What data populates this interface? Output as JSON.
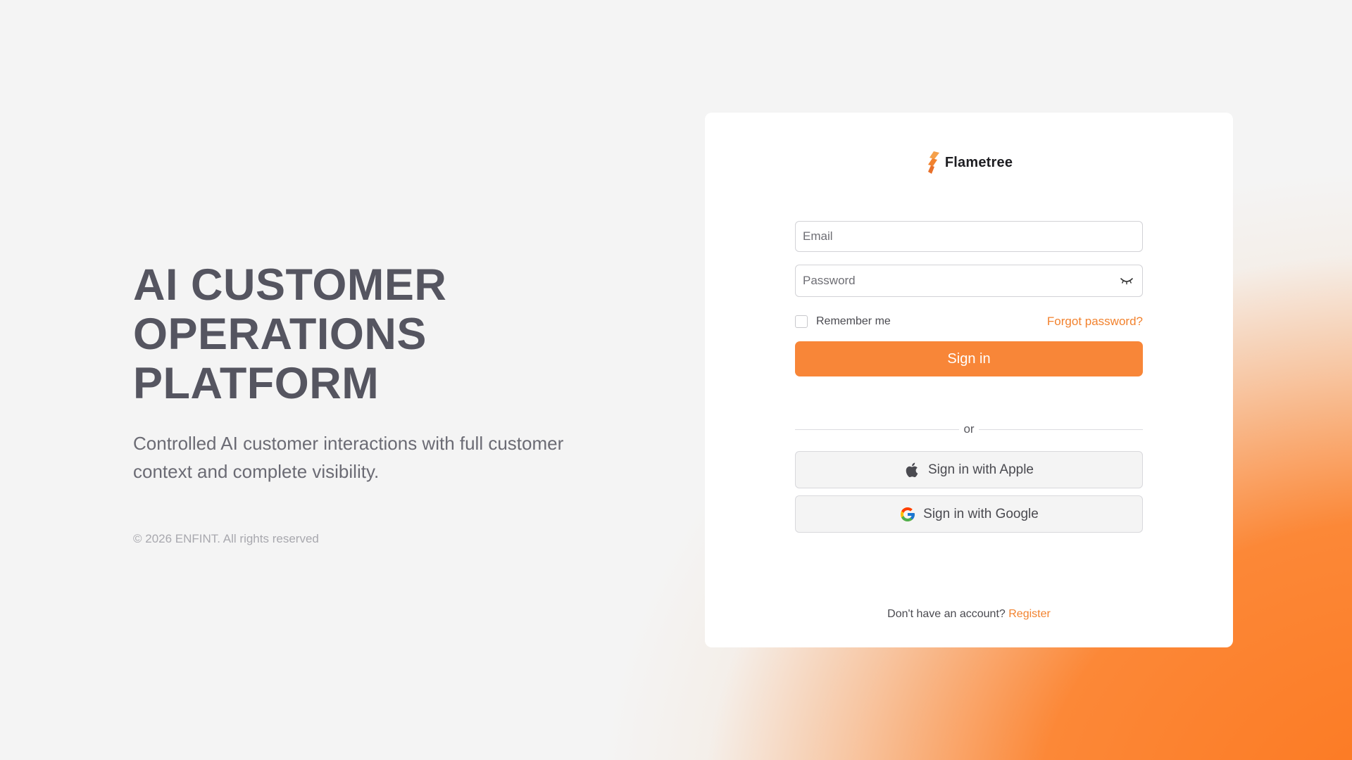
{
  "hero": {
    "title_lines": [
      "AI CUSTOMER",
      "OPERATIONS",
      "PLATFORM"
    ],
    "subtitle": "Controlled AI customer interactions with full customer context and complete visibility.",
    "copyright": "© 2026 ENFINT. All rights reserved"
  },
  "brand": {
    "name": "Flametree",
    "logo_icon": "flame-logo-icon",
    "color": "#f2822e"
  },
  "login": {
    "email_placeholder": "Email",
    "email_value": "",
    "password_placeholder": "Password",
    "password_value": "",
    "password_toggle_icon": "eye-closed-icon",
    "remember_label": "Remember me",
    "remember_checked": false,
    "forgot_label": "Forgot password?",
    "signin_label": "Sign in",
    "divider_label": "or",
    "apple_label": "Sign in with Apple",
    "apple_icon": "apple-icon",
    "google_label": "Sign in with Google",
    "google_icon": "google-icon",
    "register_prompt": "Don't have an account?",
    "register_label": "Register"
  },
  "colors": {
    "accent": "#f88638",
    "link": "#f2822e",
    "background": "#f4f4f4",
    "heading": "#555560"
  }
}
